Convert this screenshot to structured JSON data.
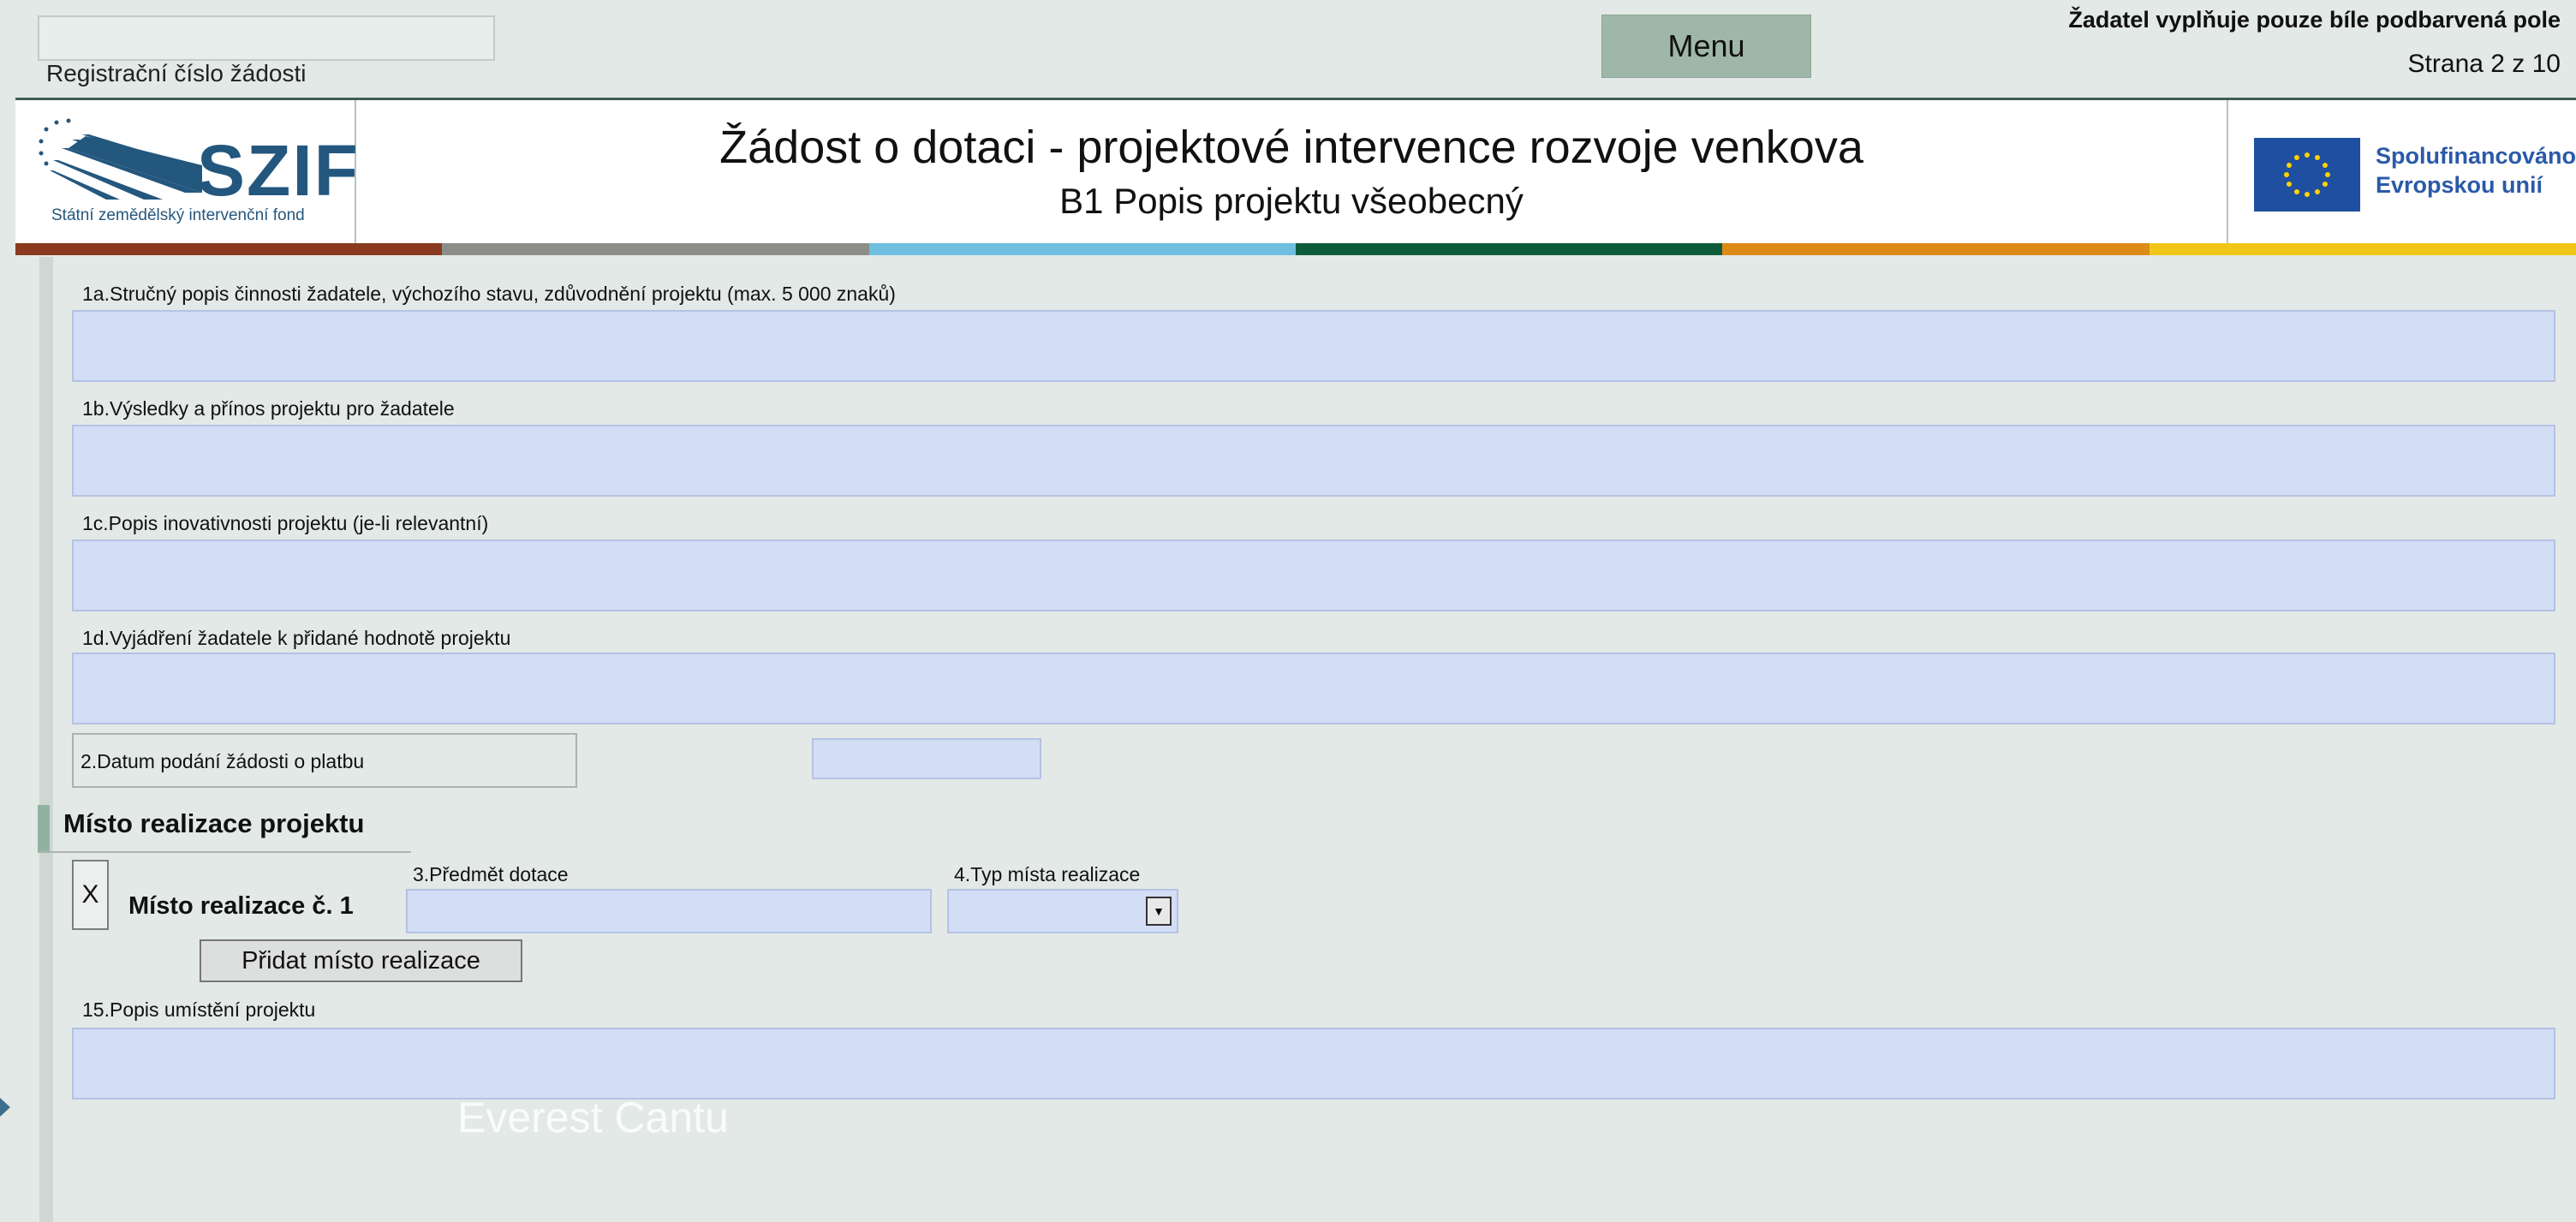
{
  "topbar": {
    "registration_label": "Registrační číslo žádosti",
    "registration_value": "",
    "menu_label": "Menu",
    "notice": "Žadatel vyplňuje pouze bíle podbarvená pole",
    "page_indicator": "Strana 2 z 10"
  },
  "header": {
    "logo_text": "SZIF",
    "logo_subtitle": "Státní zemědělský intervenční fond",
    "title": "Žádost o dotaci - projektové intervence rozvoje venkova",
    "subtitle": "B1 Popis projektu všeobecný",
    "eu_line1": "Spolufinancováno",
    "eu_line2": "Evropskou unií"
  },
  "colors": {
    "bar": [
      "#8a3a1e",
      "#8d8d8a",
      "#6ebfe0",
      "#0f5c3c",
      "#dd8a16",
      "#f2c618"
    ],
    "field_bg": "#d4ddf6",
    "panel_bg": "#e3e9e6",
    "accent": "#9fb7a8"
  },
  "fields": {
    "f1a_label": "1a.Stručný popis činnosti žadatele, výchozího stavu, zdůvodnění projektu (max. 5 000 znaků)",
    "f1b_label": "1b.Výsledky a přínos projektu pro žadatele",
    "f1c_label": "1c.Popis inovativnosti projektu (je-li relevantní)",
    "f1d_label": "1d.Vyjádření žadatele k přidané hodnotě projektu",
    "f2_label": "2.Datum podání žádosti o platbu",
    "f15_label": "15.Popis umístění projektu"
  },
  "realization": {
    "section_title": "Místo realizace projektu",
    "remove_label": "X",
    "place_label": "Místo realizace č. 1",
    "subject_label": "3.Předmět dotace",
    "type_label": "4.Typ místa realizace",
    "type_value": "",
    "add_button": "Přidat místo realizace"
  },
  "overlay": {
    "watermark": "Everest Cantu"
  }
}
